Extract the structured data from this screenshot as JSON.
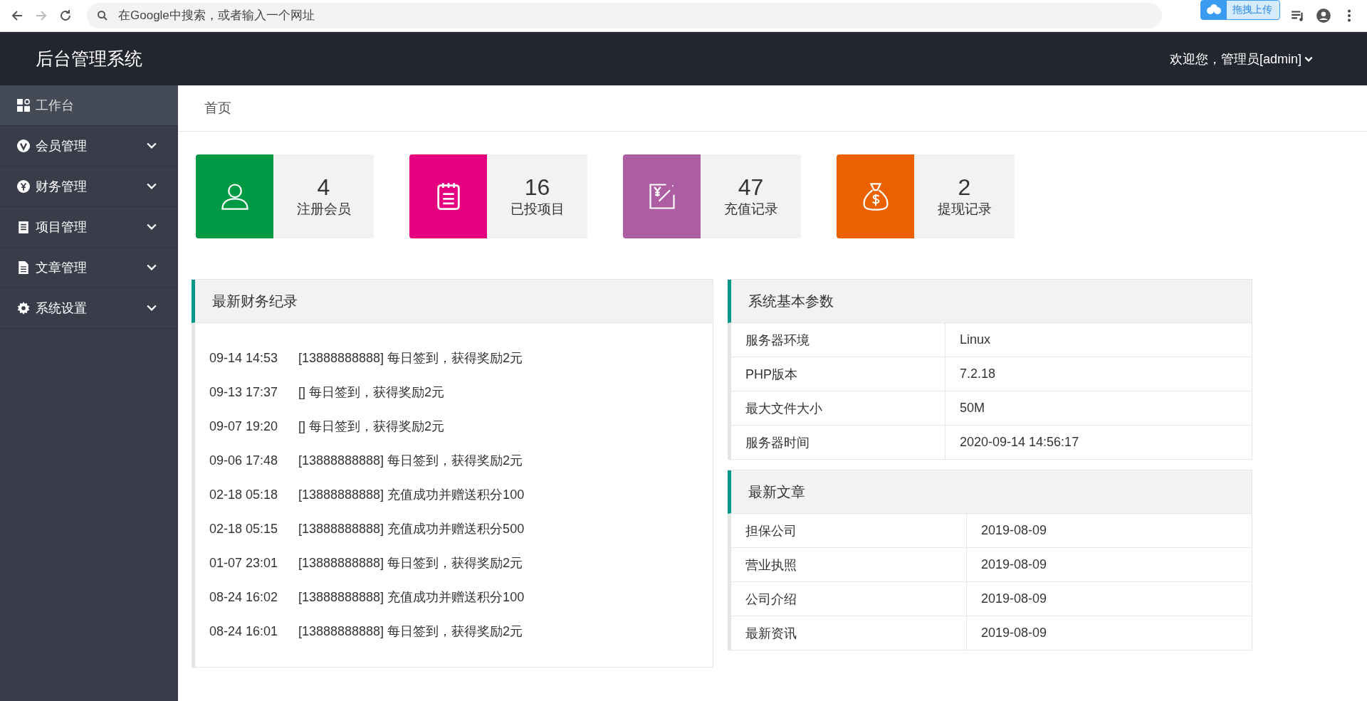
{
  "browser": {
    "address_placeholder": "在Google中搜索，或者输入一个网址",
    "upload_badge": "拖拽上传"
  },
  "header": {
    "title": "后台管理系统",
    "user": "欢迎您，管理员[admin]"
  },
  "sidebar": {
    "items": [
      {
        "label": "工作台",
        "kind": "dashboard",
        "selected": true,
        "expandable": false
      },
      {
        "label": "会员管理",
        "kind": "member",
        "selected": false,
        "expandable": true
      },
      {
        "label": "财务管理",
        "kind": "finance",
        "selected": false,
        "expandable": true
      },
      {
        "label": "项目管理",
        "kind": "project",
        "selected": false,
        "expandable": true
      },
      {
        "label": "文章管理",
        "kind": "article",
        "selected": false,
        "expandable": true
      },
      {
        "label": "系统设置",
        "kind": "settings",
        "selected": false,
        "expandable": true
      }
    ]
  },
  "breadcrumb": "首页",
  "stats": [
    {
      "value": "4",
      "label": "注册会员",
      "kind": "user",
      "color": "#009944"
    },
    {
      "value": "16",
      "label": "已投项目",
      "kind": "notepad",
      "color": "#e4007f"
    },
    {
      "value": "47",
      "label": "充值记录",
      "kind": "recharge",
      "color": "#ad5da1"
    },
    {
      "value": "2",
      "label": "提现记录",
      "kind": "moneybag",
      "color": "#eb6100"
    }
  ],
  "finance_panel": {
    "title": "最新财务纪录",
    "rows": [
      {
        "time": "09-14 14:53",
        "text": "[13888888888] 每日签到，获得奖励2元"
      },
      {
        "time": "09-13 17:37",
        "text": "[] 每日签到，获得奖励2元"
      },
      {
        "time": "09-07 19:20",
        "text": "[] 每日签到，获得奖励2元"
      },
      {
        "time": "09-06 17:48",
        "text": "[13888888888] 每日签到，获得奖励2元"
      },
      {
        "time": "02-18 05:18",
        "text": "[13888888888] 充值成功并赠送积分100"
      },
      {
        "time": "02-18 05:15",
        "text": "[13888888888] 充值成功并赠送积分500"
      },
      {
        "time": "01-07 23:01",
        "text": "[13888888888] 每日签到，获得奖励2元"
      },
      {
        "time": "08-24 16:02",
        "text": "[13888888888] 充值成功并赠送积分100"
      },
      {
        "time": "08-24 16:01",
        "text": "[13888888888] 每日签到，获得奖励2元"
      }
    ]
  },
  "system_panel": {
    "title": "系统基本参数",
    "rows": [
      {
        "name": "服务器环境",
        "value": "Linux"
      },
      {
        "name": "PHP版本",
        "value": "7.2.18"
      },
      {
        "name": "最大文件大小",
        "value": "50M"
      },
      {
        "name": "服务器时间",
        "value": "2020-09-14 14:56:17"
      }
    ]
  },
  "article_panel": {
    "title": "最新文章",
    "rows": [
      {
        "name": "担保公司",
        "value": "2019-08-09"
      },
      {
        "name": "营业执照",
        "value": "2019-08-09"
      },
      {
        "name": "公司介绍",
        "value": "2019-08-09"
      },
      {
        "name": "最新资讯",
        "value": "2019-08-09"
      }
    ]
  }
}
